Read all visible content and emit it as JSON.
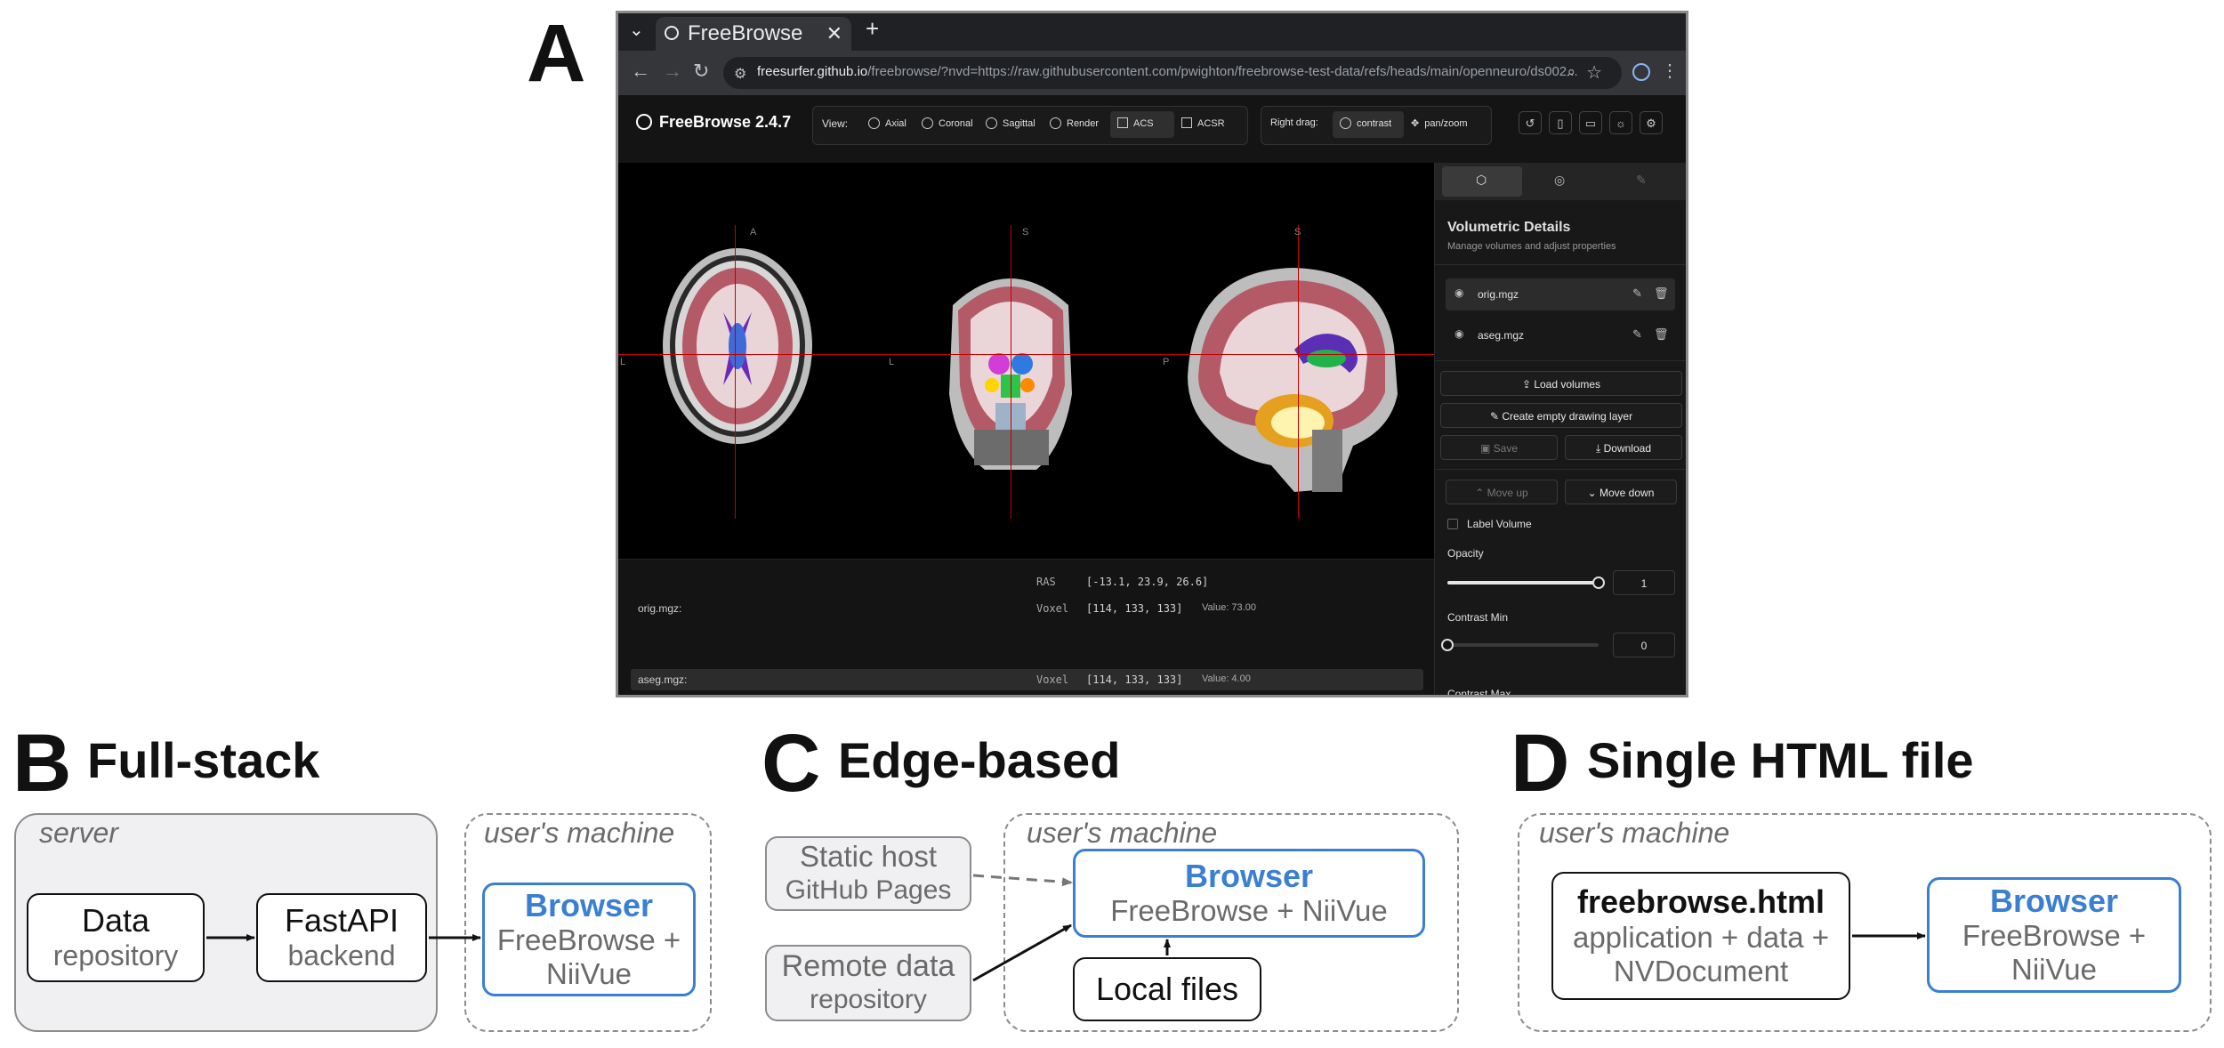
{
  "panels": {
    "a": {
      "letter": "A"
    },
    "b": {
      "letter": "B",
      "title": "Full-stack"
    },
    "c": {
      "letter": "C",
      "title": "Edge-based"
    },
    "d": {
      "letter": "D",
      "title": "Single HTML file"
    }
  },
  "browser": {
    "tab_title": "FreeBrowse",
    "url_host": "freesurfer.github.io",
    "url_rest": "/freebrowse/?nvd=https://raw.githubusercontent.com/pwighton/freebrowse-test-data/refs/heads/main/openneuro/ds002..."
  },
  "app": {
    "name": "FreeBrowse 2.4.7",
    "view_label": "View:",
    "views": [
      "Axial",
      "Coronal",
      "Sagittal",
      "Render",
      "ACS",
      "ACSR"
    ],
    "right_drag_label": "Right drag:",
    "right_drag_options": [
      "contrast",
      "pan/zoom"
    ],
    "orientation": {
      "a": "A",
      "s1": "S",
      "s2": "S",
      "l1": "L",
      "l2": "L",
      "p": "P"
    },
    "info": {
      "ras_label": "RAS",
      "ras_value": "[-13.1, 23.9, 26.6]",
      "rows": [
        {
          "file": "orig.mgz:",
          "voxel_label": "Voxel",
          "voxel": "[114, 133, 133]",
          "value": "Value: 73.00"
        },
        {
          "file": "aseg.mgz:",
          "voxel_label": "Voxel",
          "voxel": "[114, 133, 133]",
          "value": "Value: 4.00"
        }
      ]
    },
    "sidebar": {
      "title": "Volumetric Details",
      "subtitle": "Manage volumes and adjust properties",
      "volumes": [
        "orig.mgz",
        "aseg.mgz"
      ],
      "load_volumes": "Load volumes",
      "create_layer": "Create empty drawing layer",
      "save": "Save",
      "download": "Download",
      "move_up": "Move up",
      "move_down": "Move down",
      "label_volume": "Label Volume",
      "opacity_label": "Opacity",
      "opacity_value": "1",
      "opacity_level": 1.0,
      "contrast_min_label": "Contrast Min",
      "contrast_min_value": "0",
      "contrast_min_level": 0.0,
      "cut_label": "Contrast Max"
    }
  },
  "diagram": {
    "b": {
      "server_label": "server",
      "user_label": "user's machine",
      "data_repo": [
        "Data",
        "repository"
      ],
      "fastapi": [
        "FastAPI",
        "backend"
      ],
      "browser": [
        "Browser",
        "FreeBrowse +",
        "NiiVue"
      ]
    },
    "c": {
      "user_label": "user's machine",
      "static_host": [
        "Static host",
        "GitHub Pages"
      ],
      "remote_data": [
        "Remote data",
        "repository"
      ],
      "browser": [
        "Browser",
        "FreeBrowse + NiiVue"
      ],
      "local_files": "Local files"
    },
    "d": {
      "user_label": "user's machine",
      "html_file": [
        "freebrowse.html",
        "application + data +",
        "NVDocument"
      ],
      "browser": [
        "Browser",
        "FreeBrowse +",
        "NiiVue"
      ]
    }
  }
}
